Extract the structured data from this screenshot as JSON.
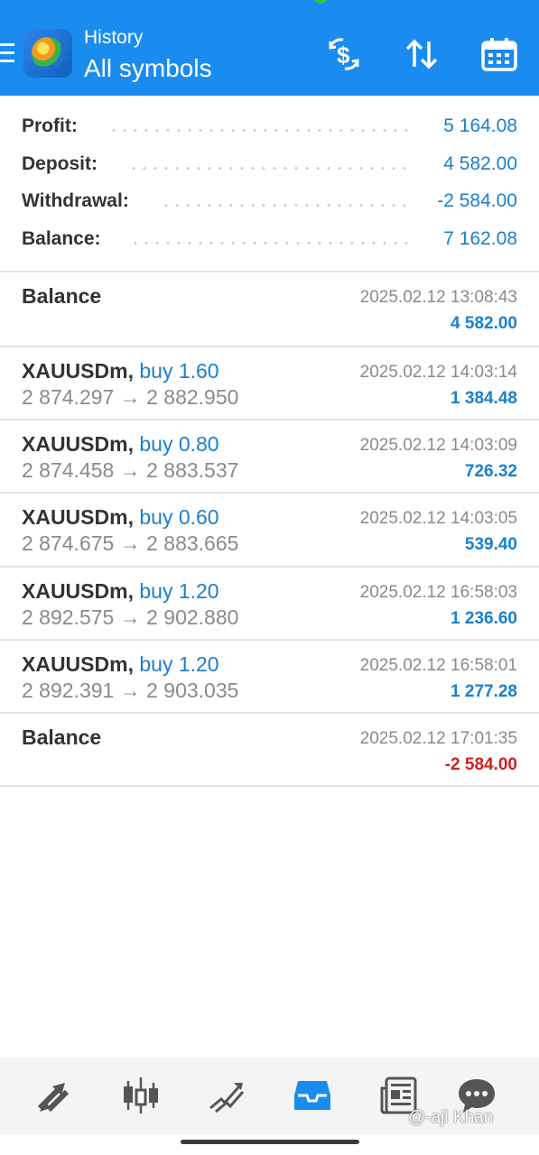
{
  "header": {
    "subtitle": "History",
    "title": "All symbols",
    "icons": [
      "menu-icon",
      "metatrader-logo",
      "dollar-exchange-icon",
      "sort-icon",
      "calendar-icon"
    ]
  },
  "summary": [
    {
      "label": "Profit:",
      "value": "5 164.08"
    },
    {
      "label": "Deposit:",
      "value": "4 582.00"
    },
    {
      "label": "Withdrawal:",
      "value": "-2 584.00"
    },
    {
      "label": "Balance:",
      "value": "7 162.08"
    }
  ],
  "deals": [
    {
      "title": "Balance",
      "time": "2025.02.12 13:08:43",
      "profit": "4 582.00",
      "sign": "pos"
    },
    {
      "symbol": "XAUUSDm,",
      "type": "buy 1.60",
      "prices": "2 874.297 → 2 882.950",
      "time": "2025.02.12 14:03:14",
      "profit": "1 384.48",
      "sign": "pos"
    },
    {
      "symbol": "XAUUSDm,",
      "type": "buy 0.80",
      "prices": "2 874.458 → 2 883.537",
      "time": "2025.02.12 14:03:09",
      "profit": "726.32",
      "sign": "pos"
    },
    {
      "symbol": "XAUUSDm,",
      "type": "buy 0.60",
      "prices": "2 874.675 → 2 883.665",
      "time": "2025.02.12 14:03:05",
      "profit": "539.40",
      "sign": "pos"
    },
    {
      "symbol": "XAUUSDm,",
      "type": "buy 1.20",
      "prices": "2 892.575 → 2 902.880",
      "time": "2025.02.12 16:58:03",
      "profit": "1 236.60",
      "sign": "pos"
    },
    {
      "symbol": "XAUUSDm,",
      "type": "buy 1.20",
      "prices": "2 892.391 → 2 903.035",
      "time": "2025.02.12 16:58:01",
      "profit": "1 277.28",
      "sign": "pos"
    },
    {
      "title": "Balance",
      "time": "2025.02.12 17:01:35",
      "profit": "-2 584.00",
      "sign": "neg"
    }
  ],
  "bottom_nav": [
    {
      "name": "quotes-tab",
      "icon": "quotes-arrows-icon"
    },
    {
      "name": "chart-tab",
      "icon": "candlestick-icon"
    },
    {
      "name": "trade-tab",
      "icon": "trade-lines-icon"
    },
    {
      "name": "history-tab",
      "icon": "inbox-icon",
      "active": true
    },
    {
      "name": "news-tab",
      "icon": "news-icon"
    },
    {
      "name": "chat-tab",
      "icon": "chat-bubble-icon"
    }
  ],
  "watermark": "@-aji Khan",
  "colors": {
    "header": "#1a8cf0",
    "positive": "#1a7fd0",
    "negative": "#d21f1f",
    "active_tab": "#1a8cf0",
    "inactive_tab": "#555555"
  }
}
